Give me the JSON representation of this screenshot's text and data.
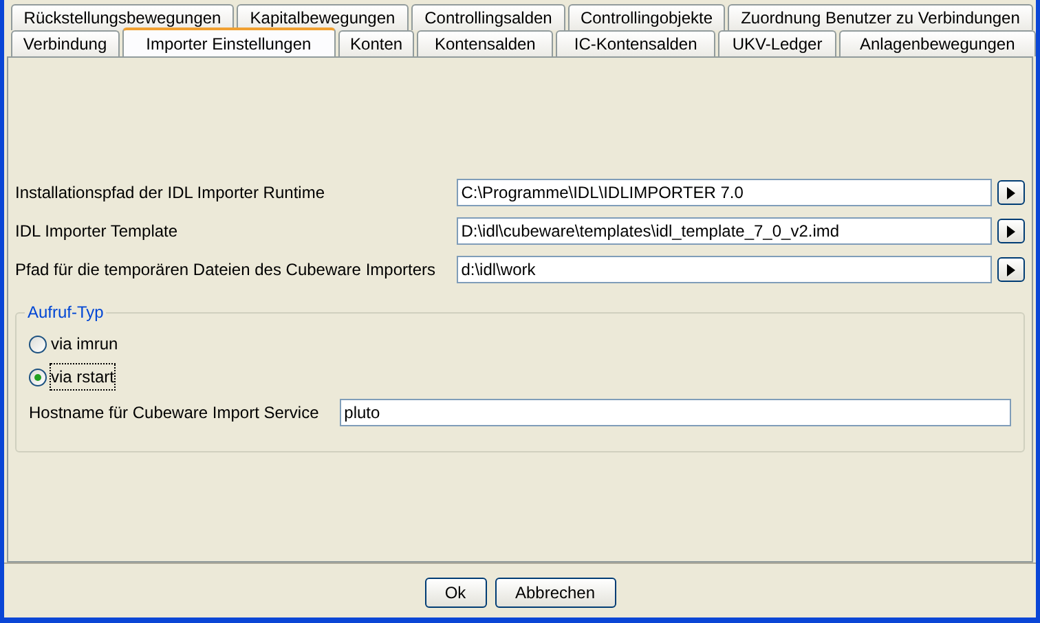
{
  "tab_rows": [
    [
      {
        "label": "Rückstellungsbewegungen",
        "selected": false
      },
      {
        "label": "Kapitalbewegungen",
        "selected": false
      },
      {
        "label": "Controllingsalden",
        "selected": false
      },
      {
        "label": "Controllingobjekte",
        "selected": false
      },
      {
        "label": "Zuordnung Benutzer zu Verbindungen",
        "selected": false
      }
    ],
    [
      {
        "label": "Verbindung",
        "selected": false
      },
      {
        "label": "Importer Einstellungen",
        "selected": true
      },
      {
        "label": "Konten",
        "selected": false
      },
      {
        "label": "Kontensalden",
        "selected": false
      },
      {
        "label": "IC-Kontensalden",
        "selected": false
      },
      {
        "label": "UKV-Ledger",
        "selected": false
      },
      {
        "label": "Anlagenbewegungen",
        "selected": false
      }
    ]
  ],
  "paths": [
    {
      "label": "Installationspfad der IDL Importer Runtime",
      "value": "C:\\Programme\\IDL\\IDLIMPORTER 7.0"
    },
    {
      "label": "IDL Importer Template",
      "value": "D:\\idl\\cubeware\\templates\\idl_template_7_0_v2.imd"
    },
    {
      "label": "Pfad für die temporären Dateien des Cubeware Importers",
      "value": "d:\\idl\\work"
    }
  ],
  "group": {
    "title": "Aufruf-Typ",
    "options": [
      {
        "label": "via imrun",
        "selected": false
      },
      {
        "label": "via rstart",
        "selected": true
      }
    ],
    "host": {
      "label": "Hostname für Cubeware Import Service",
      "value": "pluto"
    }
  },
  "buttons": [
    "Ok",
    "Abbrechen"
  ]
}
